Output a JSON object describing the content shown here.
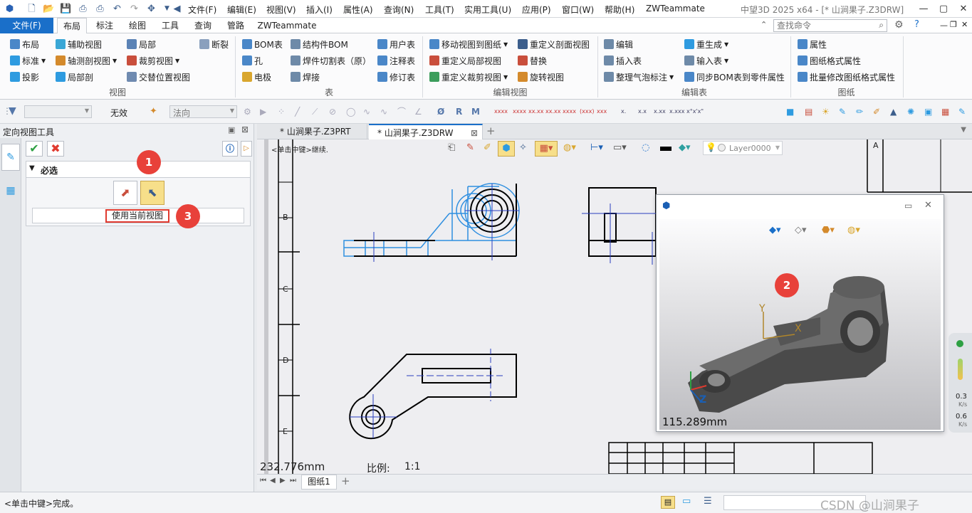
{
  "app_title": "中望3D 2025 x64 - [* 山涧果子.Z3DRW]",
  "menu": [
    "编辑(E)",
    "视图(V)",
    "插入(I)",
    "属性(A)",
    "查询(N)",
    "工具(T)",
    "实用工具(U)",
    "应用(P)",
    "窗口(W)",
    "帮助(H)",
    "ZWTeammate"
  ],
  "file_menu": "文件(F)",
  "ribbon_tabs": [
    "文件(F)",
    "布局",
    "标注",
    "绘图",
    "工具",
    "查询",
    "管路",
    "ZWTeammate"
  ],
  "active_tab": "布局",
  "search": {
    "placeholder": "查找命令"
  },
  "ribbon": {
    "view": {
      "label": "视图",
      "items": [
        "布局",
        "标准",
        "投影",
        "辅助视图",
        "轴测剖视图",
        "局部剖",
        "局部",
        "裁剪视图",
        "交替位置视图",
        "断裂"
      ]
    },
    "table": {
      "label": "表",
      "items": [
        "BOM表",
        "孔",
        "电极",
        "结构件BOM",
        "焊件切割表（原）",
        "焊接",
        "用户表",
        "注释表",
        "修订表"
      ]
    },
    "editview": {
      "label": "编辑视图",
      "items": [
        "移动视图到图纸",
        "重定义局部视图",
        "重定义裁剪视图",
        "重定义剖面视图",
        "替换",
        "旋转视图"
      ]
    },
    "edittable": {
      "label": "编辑表",
      "items": [
        "编辑",
        "插入表",
        "整理气泡标注",
        "重生成",
        "输入表",
        "同步BOM表到零件属性"
      ]
    },
    "sheet": {
      "label": "图纸",
      "items": [
        "属性",
        "图纸格式属性",
        "批量修改图纸格式属性"
      ]
    }
  },
  "toolbar2": {
    "filter_value": "无效",
    "direction_placeholder": "法向"
  },
  "panel": {
    "title": "定向视图工具",
    "section": "必选",
    "button_label": "使用当前视图"
  },
  "doc_tabs": [
    "* 山涧果子.Z3PRT",
    "* 山涧果子.Z3DRW"
  ],
  "canvas": {
    "hint": "<单击中键>继续.",
    "measure": "232.776mm",
    "scale_label": "比例:",
    "scale_value": "1:1",
    "layer": "Layer0000",
    "row_labels": [
      "B",
      "C",
      "D",
      "E"
    ],
    "col_label": "A"
  },
  "preview": {
    "measure": "115.289mm",
    "axes": [
      "Y",
      "X",
      "Z"
    ]
  },
  "callouts": [
    "1",
    "2",
    "3"
  ],
  "sheet_tab": "图纸1",
  "status": {
    "message": "<单击中键>完成。"
  },
  "speed": {
    "v1": "0.3",
    "u1": "K/s",
    "v2": "0.6",
    "u2": "K/s"
  },
  "watermark": "CSDN @山涧果子",
  "colors": {
    "accent": "#1a6fc9",
    "callout": "#e8413a",
    "model": "#4a4a4a",
    "sel": "#2f8fe0"
  }
}
